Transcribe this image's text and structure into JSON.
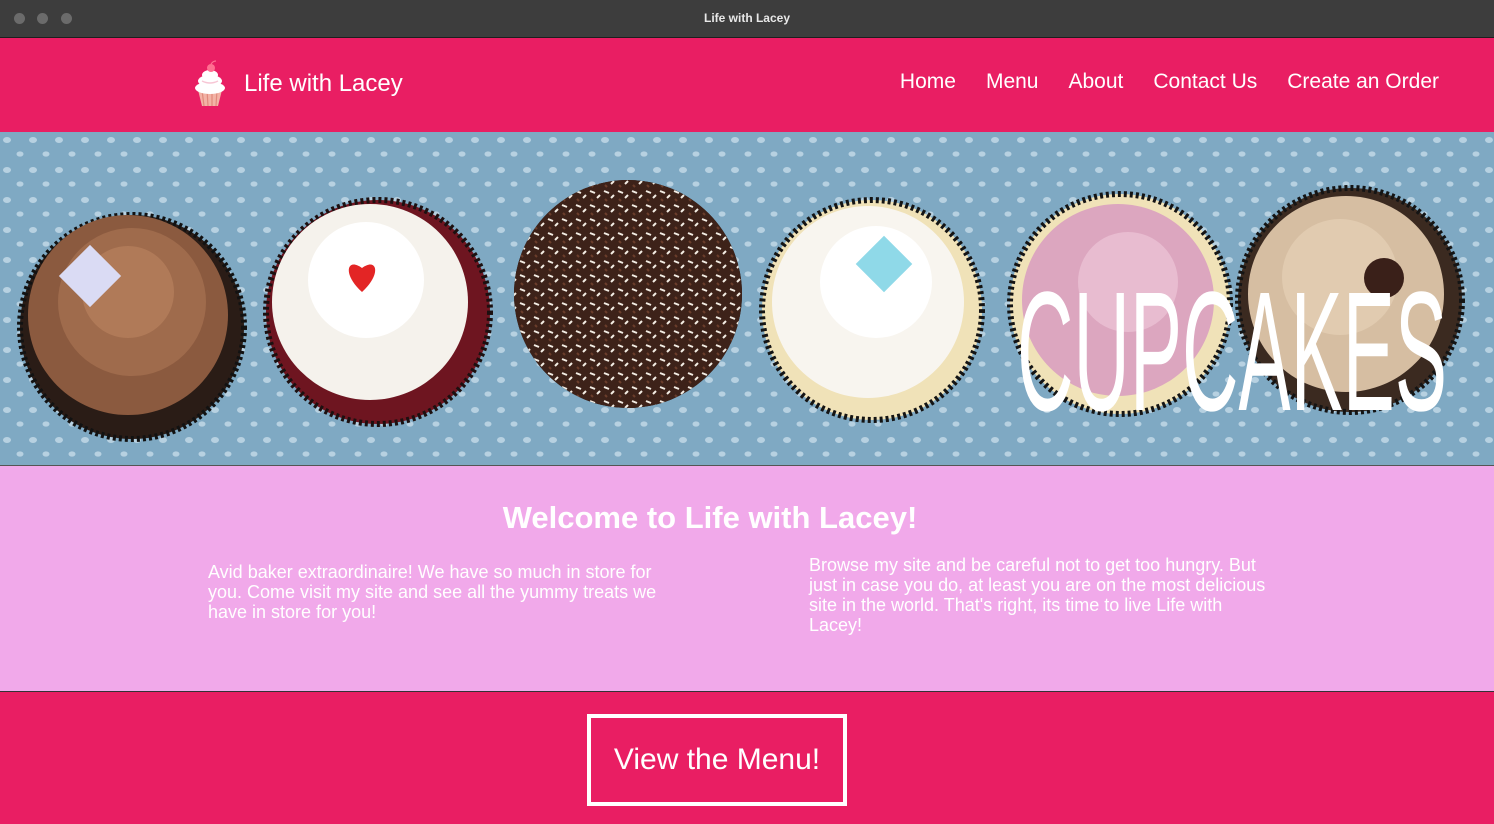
{
  "window": {
    "title": "Life with Lacey"
  },
  "header": {
    "brand": "Life with Lacey",
    "nav": [
      {
        "label": "Home"
      },
      {
        "label": "Menu"
      },
      {
        "label": "About"
      },
      {
        "label": "Contact Us"
      },
      {
        "label": "Create an Order"
      }
    ]
  },
  "hero": {
    "overlay_text": "CUPCAKES"
  },
  "welcome": {
    "title": "Welcome to Life with Lacey!",
    "left_text": "Avid baker extraordinaire! We have so much in store for you. Come visit my site and see all the yummy treats we have in store for you!",
    "right_text": "Browse my site and be careful not to get too hungry. But just in case you do, at least you are on the most delicious site in the world. That's right, its time to live Life with Lacey!"
  },
  "cta": {
    "label": "View the Menu!"
  },
  "colors": {
    "primary": "#e91e63",
    "welcome_bg": "#f1a9ea",
    "hero_bg": "#7fa9c3",
    "titlebar": "#3d3d3d"
  }
}
